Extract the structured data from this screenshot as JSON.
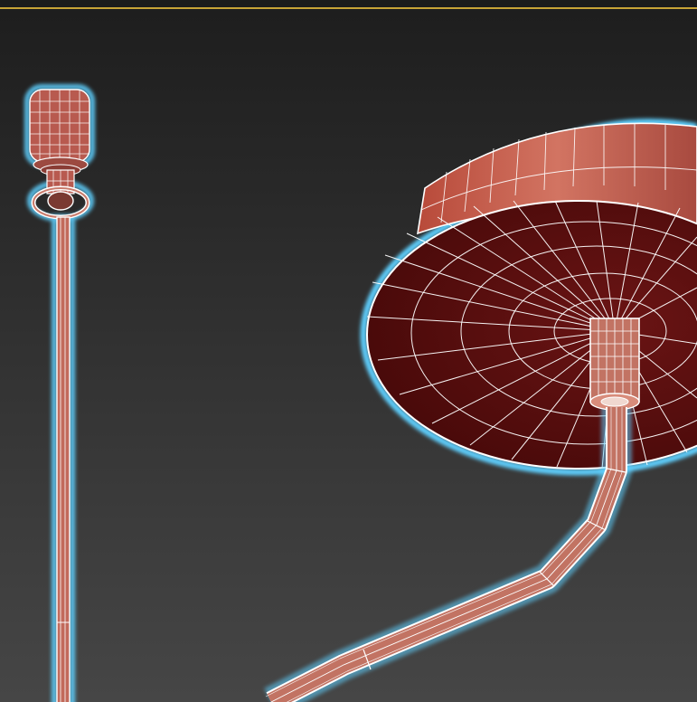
{
  "viewport": {
    "label": "",
    "active_border_color": "#c8a436",
    "background_top": "#1e1e1e",
    "background_bottom": "#464646"
  },
  "selection_color": "#5fd0ff",
  "wire_color": "#ffffff",
  "objects": [
    {
      "name": "pendant-cable-left",
      "material_color": "#b85a4f"
    },
    {
      "name": "ceiling-canopy",
      "material_color": "#a84a3f",
      "underside_color": "#5a0f0f"
    },
    {
      "name": "bent-arm-tube",
      "material_color": "#c27363"
    }
  ]
}
